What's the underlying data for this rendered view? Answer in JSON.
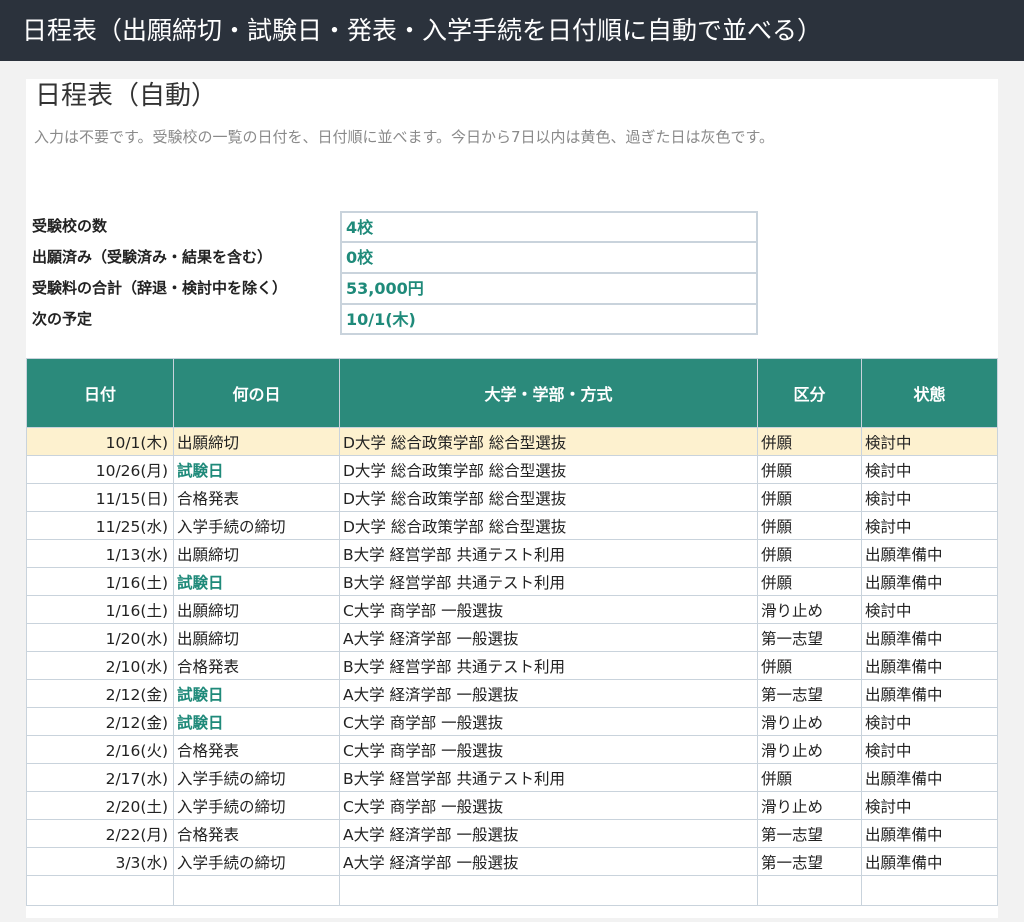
{
  "window": {
    "title": "日程表（出願締切・試験日・発表・入学手続を日付順に自動で並べる）"
  },
  "sheet": {
    "title": "日程表（自動）",
    "description": "入力は不要です。受験校の一覧の日付を、日付順に並べます。今日から7日以内は黄色、過ぎた日は灰色です。"
  },
  "summary": [
    {
      "label": "受験校の数",
      "value": "4校"
    },
    {
      "label": "出願済み（受験済み・結果を含む）",
      "value": "0校"
    },
    {
      "label": "受験料の合計（辞退・検討中を除く）",
      "value": "53,000円"
    },
    {
      "label": "次の予定",
      "value": "10/1(木)"
    }
  ],
  "table": {
    "headers": [
      "日付",
      "何の日",
      "大学・学部・方式",
      "区分",
      "状態"
    ],
    "rows": [
      {
        "date": "10/1(木)",
        "event": "出願締切",
        "school": "D大学 総合政策学部 総合型選抜",
        "category": "併願",
        "status": "検討中"
      },
      {
        "date": "10/26(月)",
        "event": "試験日",
        "school": "D大学 総合政策学部 総合型選抜",
        "category": "併願",
        "status": "検討中"
      },
      {
        "date": "11/15(日)",
        "event": "合格発表",
        "school": "D大学 総合政策学部 総合型選抜",
        "category": "併願",
        "status": "検討中"
      },
      {
        "date": "11/25(水)",
        "event": "入学手続の締切",
        "school": "D大学 総合政策学部 総合型選抜",
        "category": "併願",
        "status": "検討中"
      },
      {
        "date": "1/13(水)",
        "event": "出願締切",
        "school": "B大学 経営学部 共通テスト利用",
        "category": "併願",
        "status": "出願準備中"
      },
      {
        "date": "1/16(土)",
        "event": "試験日",
        "school": "B大学 経営学部 共通テスト利用",
        "category": "併願",
        "status": "出願準備中"
      },
      {
        "date": "1/16(土)",
        "event": "出願締切",
        "school": "C大学 商学部 一般選抜",
        "category": "滑り止め",
        "status": "検討中"
      },
      {
        "date": "1/20(水)",
        "event": "出願締切",
        "school": "A大学 経済学部 一般選抜",
        "category": "第一志望",
        "status": "出願準備中"
      },
      {
        "date": "2/10(水)",
        "event": "合格発表",
        "school": "B大学 経営学部 共通テスト利用",
        "category": "併願",
        "status": "出願準備中"
      },
      {
        "date": "2/12(金)",
        "event": "試験日",
        "school": "A大学 経済学部 一般選抜",
        "category": "第一志望",
        "status": "出願準備中"
      },
      {
        "date": "2/12(金)",
        "event": "試験日",
        "school": "C大学 商学部 一般選抜",
        "category": "滑り止め",
        "status": "検討中"
      },
      {
        "date": "2/16(火)",
        "event": "合格発表",
        "school": "C大学 商学部 一般選抜",
        "category": "滑り止め",
        "status": "検討中"
      },
      {
        "date": "2/17(水)",
        "event": "入学手続の締切",
        "school": "B大学 経営学部 共通テスト利用",
        "category": "併願",
        "status": "出願準備中"
      },
      {
        "date": "2/20(土)",
        "event": "入学手続の締切",
        "school": "C大学 商学部 一般選抜",
        "category": "滑り止め",
        "status": "検討中"
      },
      {
        "date": "2/22(月)",
        "event": "合格発表",
        "school": "A大学 経済学部 一般選抜",
        "category": "第一志望",
        "status": "出願準備中"
      },
      {
        "date": "3/3(水)",
        "event": "入学手続の締切",
        "school": "A大学 経済学部 一般選抜",
        "category": "第一志望",
        "status": "出願準備中"
      }
    ]
  },
  "colors": {
    "header_bg": "#2b8a7b",
    "accent_text": "#1f8a7a",
    "highlight_row": "#fdf1cf",
    "titlebar_bg": "#2b323c"
  }
}
